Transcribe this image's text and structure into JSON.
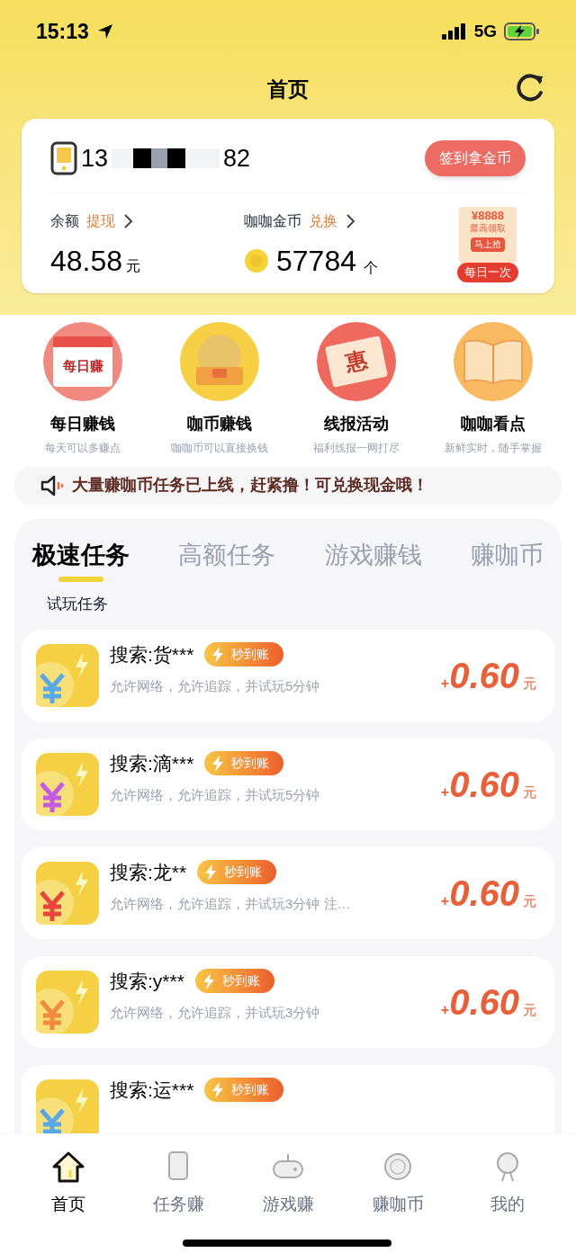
{
  "status_bar": {
    "time": "15:13",
    "network": "5G"
  },
  "header": {
    "title": "首页"
  },
  "account": {
    "phone_prefix": "13",
    "phone_suffix": "82",
    "checkin_button": "签到拿金币",
    "balance_label": "余额",
    "withdraw_link": "提现",
    "balance": "48.58",
    "balance_unit": "元",
    "coins_label": "咖咖金币",
    "exchange_link": "兑换",
    "coins": "57784",
    "coins_unit": "个",
    "promo_amount": "¥8888",
    "promo_caption": "最高领取",
    "promo_button": "马上抢",
    "promo_tag": "每日一次"
  },
  "features": [
    {
      "kind": "calendar",
      "icon_text": "每日赚",
      "title": "每日赚钱",
      "subtitle": "每天可以多赚点"
    },
    {
      "kind": "chest",
      "title": "咖币赚钱",
      "subtitle": "咖咖币可以直接换钱"
    },
    {
      "kind": "ticket",
      "icon_text": "惠",
      "title": "线报活动",
      "subtitle": "福利线报一网打尽"
    },
    {
      "kind": "book",
      "title": "咖咖看点",
      "subtitle": "新鲜实时，随手掌握"
    }
  ],
  "notice": "大量赚咖币任务已上线，赶紧撸！可兑换现金哦！",
  "task_tabs": [
    {
      "label": "极速任务",
      "selected": true
    },
    {
      "label": "高额任务",
      "selected": false
    },
    {
      "label": "游戏赚钱",
      "selected": false
    },
    {
      "label": "赚咖币",
      "selected": false
    }
  ],
  "section_title": "试玩任务",
  "tasks": [
    {
      "title": "搜索:货***",
      "badge": "秒到账",
      "description": "允许网络，允许追踪，并试玩5分钟",
      "reward_sign": "+",
      "reward": "0.60",
      "unit": "元",
      "color": "#5aa7e6"
    },
    {
      "title": "搜索:滴***",
      "badge": "秒到账",
      "description": "允许网络，允许追踪，并试玩5分钟",
      "reward_sign": "+",
      "reward": "0.60",
      "unit": "元",
      "color": "#c45be0"
    },
    {
      "title": "搜索:龙**",
      "badge": "秒到账",
      "description": "允许网络，允许追踪，并试玩3分钟 注…",
      "reward_sign": "+",
      "reward": "0.60",
      "unit": "元",
      "color": "#e8453c"
    },
    {
      "title": "搜索:y***",
      "badge": "秒到账",
      "description": "允许网络，允许追踪，并试玩3分钟",
      "reward_sign": "+",
      "reward": "0.60",
      "unit": "元",
      "color": "#f08a3c"
    },
    {
      "title": "搜索:运***",
      "badge": "秒到账",
      "color": "#5aa7e6"
    }
  ],
  "tab_bar": [
    {
      "kind": "home",
      "label": "首页",
      "selected": true
    },
    {
      "kind": "task",
      "label": "任务赚",
      "selected": false
    },
    {
      "kind": "game",
      "label": "游戏赚",
      "selected": false
    },
    {
      "kind": "coin",
      "label": "赚咖币",
      "selected": false
    },
    {
      "kind": "me",
      "label": "我的",
      "selected": false
    }
  ]
}
